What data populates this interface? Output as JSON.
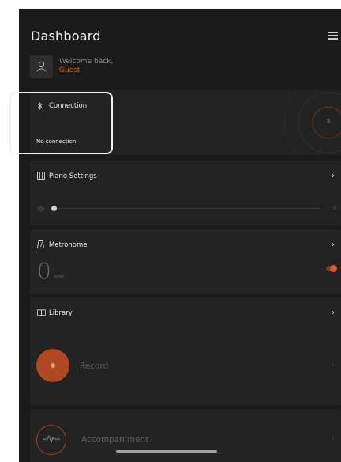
{
  "header": {
    "title": "Dashboard",
    "menu_icon": "menu-icon"
  },
  "user": {
    "welcome": "Welcome back,",
    "name": "Guest",
    "avatar_icon": "user-icon"
  },
  "connection": {
    "title": "Connection",
    "status": "No connection",
    "icon": "bluetooth-icon"
  },
  "piano_settings": {
    "title": "Piano Settings",
    "volume_value": "0",
    "volume_level": 0
  },
  "metronome": {
    "title": "Metronome",
    "bpm": "0",
    "bpm_unit": "BPM ,",
    "enabled": true
  },
  "library": {
    "title": "Library"
  },
  "record": {
    "label": "Record"
  },
  "accompaniment": {
    "label": "Accompaniment"
  },
  "colors": {
    "accent": "#e0552b",
    "background": "#1b1b1b",
    "card": "#232323"
  }
}
